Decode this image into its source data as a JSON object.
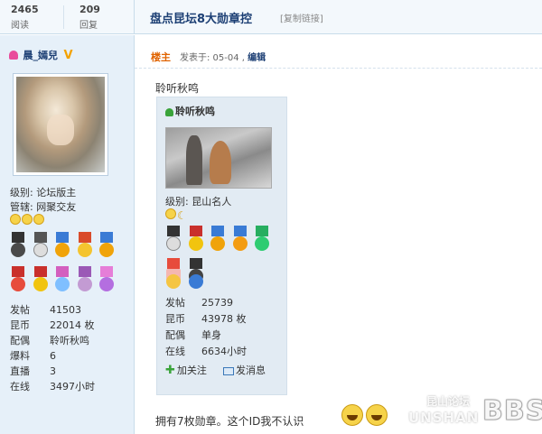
{
  "header": {
    "views_count": "2465",
    "views_label": "阅读",
    "replies_count": "209",
    "replies_label": "回复",
    "title": "盘点昆坛8大勋章控",
    "copy_link": "[复制链接]"
  },
  "sidebar": {
    "username": "晨_嫣兒",
    "level": "级别: 论坛版主",
    "management": "管辖: 网聚交友",
    "stats": [
      {
        "key": "发帖",
        "value": "41503"
      },
      {
        "key": "昆币",
        "value": "22014 枚"
      },
      {
        "key": "配偶",
        "value": "聆听秋鸣"
      },
      {
        "key": "爆料",
        "value": "6"
      },
      {
        "key": "直播",
        "value": "3"
      },
      {
        "key": "在线",
        "value": "3497小时"
      }
    ]
  },
  "post": {
    "poster_badge": "楼主",
    "meta": "发表于: 05-04 ,",
    "edit_label": "编辑",
    "intro": "聆听秋鸣",
    "reply": "拥有7枚勋章。这个ID我不认识"
  },
  "embed": {
    "username": "聆听秋鸣",
    "level": "级别: 昆山名人",
    "stats": [
      {
        "key": "发帖",
        "value": "25739"
      },
      {
        "key": "昆币",
        "value": "43978 枚"
      },
      {
        "key": "配偶",
        "value": "单身"
      },
      {
        "key": "在线",
        "value": "6634小时"
      }
    ],
    "add_follow": "加关注",
    "send_message": "发消息"
  },
  "watermark": {
    "line1": "昆山论坛",
    "line2": "UNSHAN",
    "bbs": "BBS"
  },
  "colors": {
    "title": "#1c3f74",
    "sidebar_bg": "#e6f0f9",
    "poster_badge": "#e06300",
    "embed_bg": "#e2ebf3"
  }
}
